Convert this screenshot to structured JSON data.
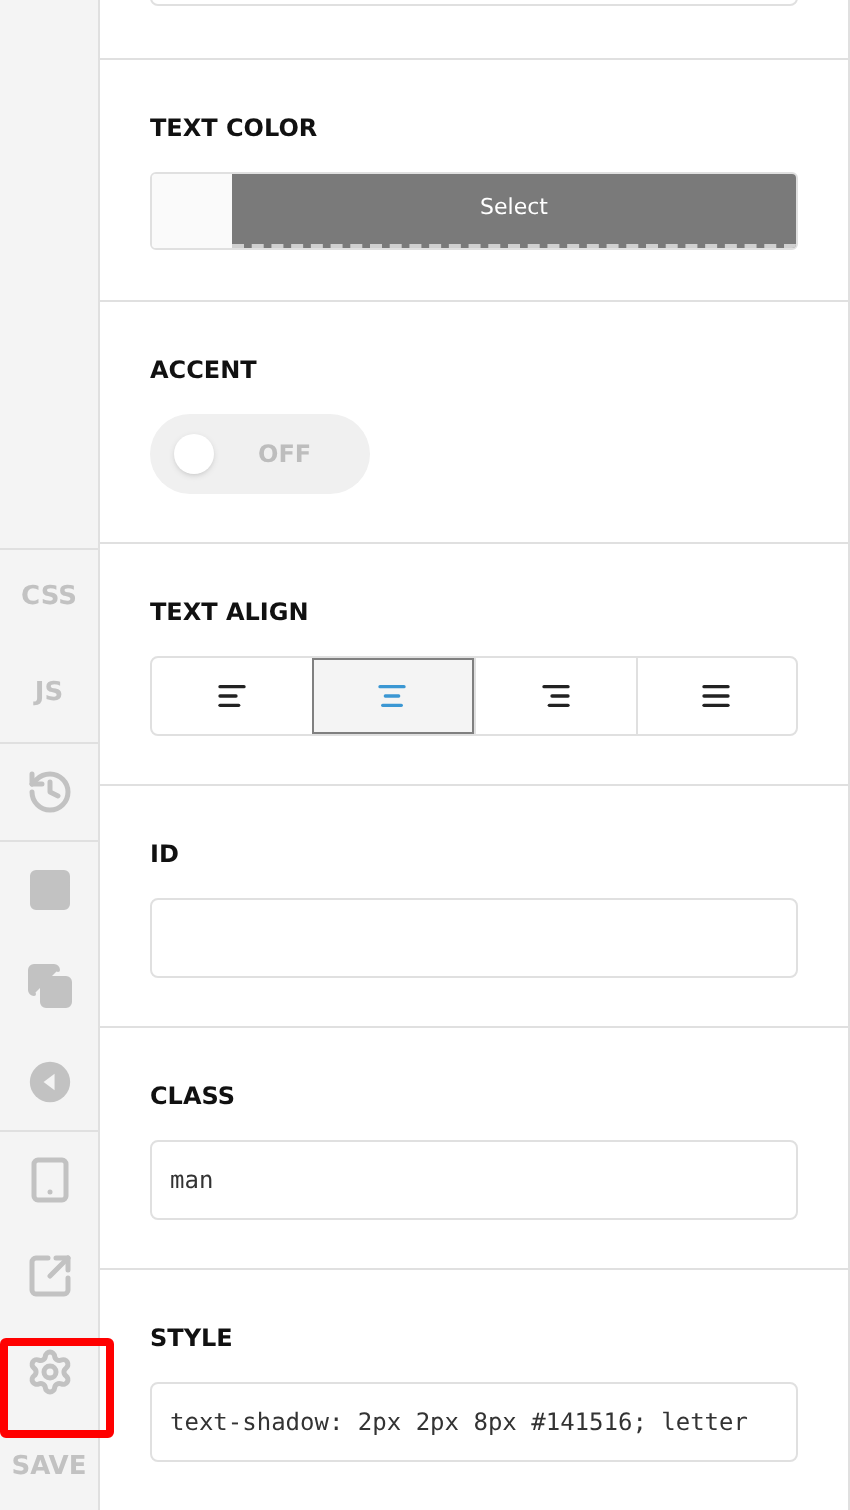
{
  "sidebar": {
    "groups": [
      {
        "items": [
          {
            "kind": "text",
            "label": "CSS",
            "selected": false
          },
          {
            "kind": "text",
            "label": "JS",
            "selected": false
          }
        ]
      },
      {
        "items": [
          {
            "kind": "history",
            "selected": false
          }
        ]
      },
      {
        "items": [
          {
            "kind": "layout",
            "selected": false
          },
          {
            "kind": "copies",
            "selected": false
          },
          {
            "kind": "back",
            "selected": false
          }
        ]
      },
      {
        "items": [
          {
            "kind": "mobile",
            "selected": false
          },
          {
            "kind": "external",
            "selected": false
          },
          {
            "kind": "settings",
            "selected": true
          },
          {
            "kind": "text",
            "label": "SAVE",
            "selected": false
          }
        ]
      }
    ]
  },
  "sections": [
    {
      "kind": "color",
      "label": "TEXT COLOR",
      "button": "Select"
    },
    {
      "kind": "toggle",
      "label": "ACCENT",
      "on": false,
      "state_label": "OFF"
    },
    {
      "kind": "align",
      "label": "TEXT ALIGN",
      "options": [
        {
          "kind": "left",
          "selected": false
        },
        {
          "kind": "center",
          "selected": true
        },
        {
          "kind": "right",
          "selected": false
        },
        {
          "kind": "justify",
          "selected": false
        }
      ]
    },
    {
      "kind": "input",
      "label": "ID"
    },
    {
      "kind": "input",
      "label": "CLASS",
      "value": "man"
    },
    {
      "kind": "input",
      "label": "STYLE",
      "value": "text-shadow: 2px 2px 8px #141516; letter"
    }
  ]
}
